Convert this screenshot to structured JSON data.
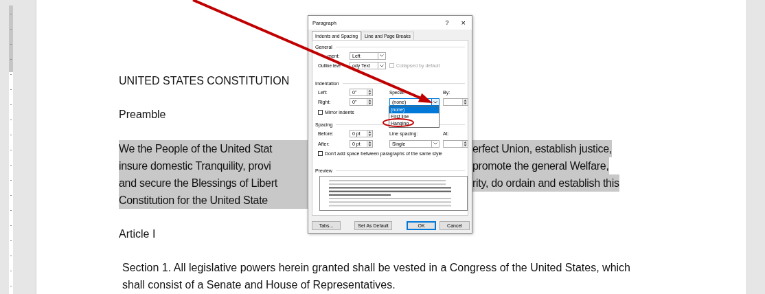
{
  "document": {
    "blocks": [
      {
        "kind": "line",
        "text": "UNITED STATES CONSTITUTION"
      },
      {
        "kind": "line",
        "text": "Preamble"
      },
      {
        "kind": "split",
        "highlighted": true,
        "lines": [
          {
            "left": "We the People of the United Stat",
            "right": "erfect Union, establish justice,"
          },
          {
            "left": "insure domestic Tranquility, provi",
            "right": "promote the general Welfare,"
          },
          {
            "left": "and secure the Blessings of Libert",
            "right": "rity, do ordain and establish this"
          },
          {
            "left": "Constitution for the United State"
          }
        ]
      },
      {
        "kind": "line",
        "text": "Article I"
      },
      {
        "kind": "para",
        "text": "Section 1. All legislative powers herein granted shall be vested in a Congress of the United States, which shall consist of a Senate and House of Representatives."
      }
    ]
  },
  "dialog": {
    "title": "Paragraph",
    "help": "?",
    "close": "×",
    "tabs": [
      {
        "label": "Indents and Spacing",
        "selected": true
      },
      {
        "label": "Line and Page Breaks",
        "selected": false
      }
    ],
    "general": {
      "label": "General",
      "alignment": {
        "label": "ment:",
        "value": "Left"
      },
      "outline_level": {
        "label": "Outline leve",
        "value": "ody Text"
      },
      "collapsed": {
        "label": "Collapsed by default",
        "checked": false,
        "disabled": true
      }
    },
    "indentation": {
      "label": "Indentation",
      "left": {
        "label": "Left:",
        "value": "0\""
      },
      "right": {
        "label": "Right:",
        "value": "0\""
      },
      "special": {
        "label": "Special:",
        "value": "(none)",
        "expanded": true,
        "options": [
          {
            "label": "(none)",
            "selected": true
          },
          {
            "label": "First line",
            "selected": false
          },
          {
            "label": "Hanging",
            "selected": false
          }
        ]
      },
      "by": {
        "label": "By:"
      },
      "mirror": {
        "label": "Mirror indents",
        "checked": false
      }
    },
    "spacing": {
      "label": "Spacing",
      "before": {
        "label": "Before:",
        "value": "0 pt"
      },
      "after": {
        "label": "After:",
        "value": "0 pt"
      },
      "line_spacing": {
        "label": "Line spacing:",
        "value": "Single"
      },
      "at": {
        "label": "At:"
      },
      "no_space": {
        "label": "Don't add space between paragraphs of the same style",
        "checked": false
      }
    },
    "preview": {
      "label": "Preview"
    },
    "buttons": [
      {
        "label": "Tabs...",
        "default": false
      },
      {
        "label": "Set As Default",
        "default": false
      },
      {
        "label": "OK",
        "default": true
      },
      {
        "label": "Cancel",
        "default": false
      }
    ]
  }
}
